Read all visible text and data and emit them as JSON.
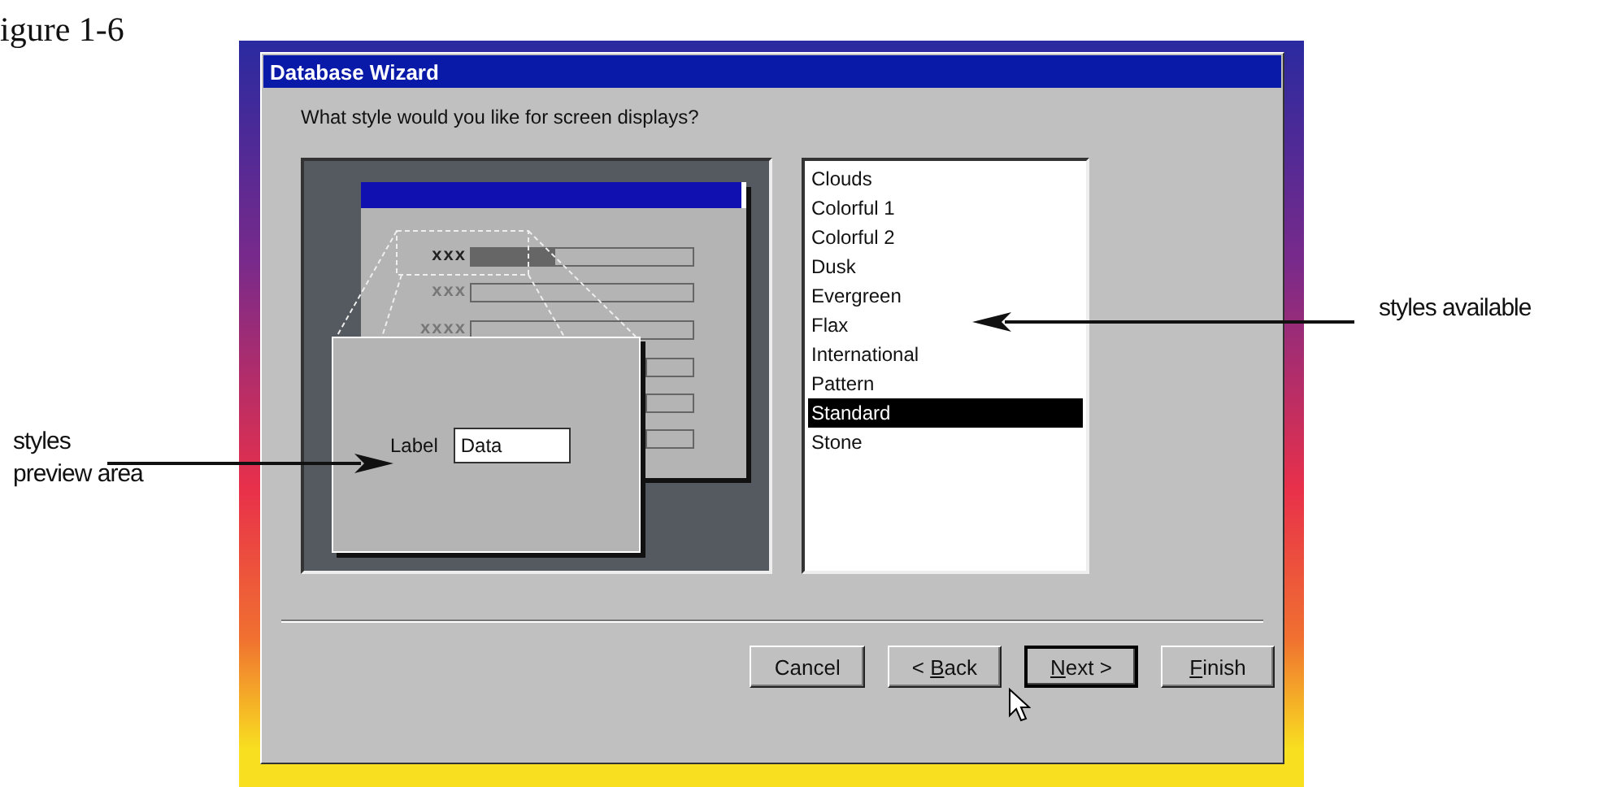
{
  "figure_label": "igure 1-6",
  "window": {
    "title": "Database Wizard"
  },
  "prompt": "What style would you like for screen displays?",
  "preview": {
    "rows": [
      "xxx",
      "xxx",
      "xxxx"
    ],
    "label": "Label",
    "value": "Data"
  },
  "styles": [
    {
      "label": "Clouds",
      "selected": false
    },
    {
      "label": "Colorful 1",
      "selected": false
    },
    {
      "label": "Colorful 2",
      "selected": false
    },
    {
      "label": "Dusk",
      "selected": false
    },
    {
      "label": "Evergreen",
      "selected": false
    },
    {
      "label": "Flax",
      "selected": false
    },
    {
      "label": "International",
      "selected": false
    },
    {
      "label": "Pattern",
      "selected": false
    },
    {
      "label": "Standard",
      "selected": true
    },
    {
      "label": "Stone",
      "selected": false
    }
  ],
  "buttons": [
    {
      "after": "Cancel",
      "default": false
    },
    {
      "before": "< ",
      "key": "B",
      "after": "ack",
      "default": false
    },
    {
      "key": "N",
      "after": "ext >",
      "default": true
    },
    {
      "key": "F",
      "after": "inish",
      "default": false
    }
  ],
  "callouts": [
    {
      "kind": "right",
      "lines": [
        "styles available"
      ]
    },
    {
      "kind": "left",
      "lines": [
        "styles",
        "preview area"
      ]
    }
  ]
}
